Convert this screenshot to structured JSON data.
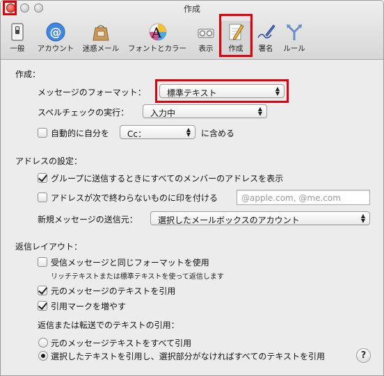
{
  "window": {
    "title": "作成"
  },
  "toolbar": {
    "items": [
      {
        "label": "一般",
        "icon": "switch-icon"
      },
      {
        "label": "アカウント",
        "icon": "at-sign-icon"
      },
      {
        "label": "迷惑メール",
        "icon": "junk-mail-bag-icon"
      },
      {
        "label": "フォントとカラー",
        "icon": "font-color-icon"
      },
      {
        "label": "表示",
        "icon": "viewing-glasses-icon"
      },
      {
        "label": "作成",
        "icon": "compose-pencil-icon",
        "selected": true
      },
      {
        "label": "署名",
        "icon": "signature-pen-icon"
      },
      {
        "label": "ルール",
        "icon": "rules-arrows-icon"
      }
    ]
  },
  "compose": {
    "heading": "作成：",
    "format_label": "メッセージのフォーマット：",
    "format_value": "標準テキスト",
    "spell_label": "スペルチェックの実行：",
    "spell_value": "入力中",
    "auto_self_label": "自動的に自分を",
    "auto_self_value": "Cc：",
    "auto_self_suffix": "に含める",
    "auto_self_checked": false
  },
  "addressing": {
    "heading": "アドレスの設定：",
    "group_label": "グループに送信するときにすべてのメンバーのアドレスを表示",
    "group_checked": true,
    "mark_label": "アドレスが次で終わらないものに印を付ける",
    "mark_checked": false,
    "mark_placeholder": "@apple.com, @me.com",
    "send_from_label": "新規メッセージの送信元：",
    "send_from_value": "選択したメールボックスのアカウント"
  },
  "responding": {
    "heading": "返信レイアウト：",
    "same_format_label": "受信メッセージと同じフォーマットを使用",
    "same_format_checked": false,
    "same_format_note": "リッチテキストまたは標準テキストを使って返信します",
    "quote_label": "元のメッセージのテキストを引用",
    "quote_checked": true,
    "increase_label": "引用マークを増やす",
    "increase_checked": true,
    "quoting_heading": "返信または転送でのテキストの引用：",
    "option_all": "元のメッセージテキストをすべて引用",
    "option_selected": "選択したテキストを引用し、選択部分がなければすべてのテキストを引用",
    "selected_option": "selected"
  },
  "help": {
    "label": "?"
  },
  "colors": {
    "highlight": "#e0000a",
    "window_bg": "#ececec"
  }
}
